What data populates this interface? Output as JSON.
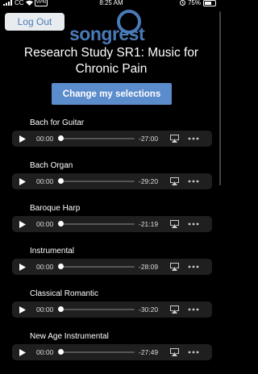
{
  "status_bar": {
    "carrier": "CC",
    "vpn": "VPN",
    "time": "8:25 AM",
    "battery": "75%",
    "battery_level": 0.75
  },
  "header": {
    "logout_label": "Log Out",
    "logo_text": "songrest",
    "brand_color": "#4a7ab8"
  },
  "page": {
    "title": "Research Study SR1: Music for Chronic Pain",
    "change_button_label": "Change my selections"
  },
  "tracks": [
    {
      "title": "Bach for Guitar",
      "current": "00:00",
      "remaining": "-27:00",
      "progress": 0
    },
    {
      "title": "Bach Organ",
      "current": "00:00",
      "remaining": "-29:20",
      "progress": 0
    },
    {
      "title": "Baroque Harp",
      "current": "00:00",
      "remaining": "-21:19",
      "progress": 0
    },
    {
      "title": "Instrumental",
      "current": "00:00",
      "remaining": "-28:09",
      "progress": 0
    },
    {
      "title": "Classical Romantic",
      "current": "00:00",
      "remaining": "-30:20",
      "progress": 0
    },
    {
      "title": "New Age Instrumental",
      "current": "00:00",
      "remaining": "-27:49",
      "progress": 0
    }
  ],
  "icons": {
    "play": "play-icon",
    "airplay": "airplay-icon",
    "more": "more-icon"
  }
}
